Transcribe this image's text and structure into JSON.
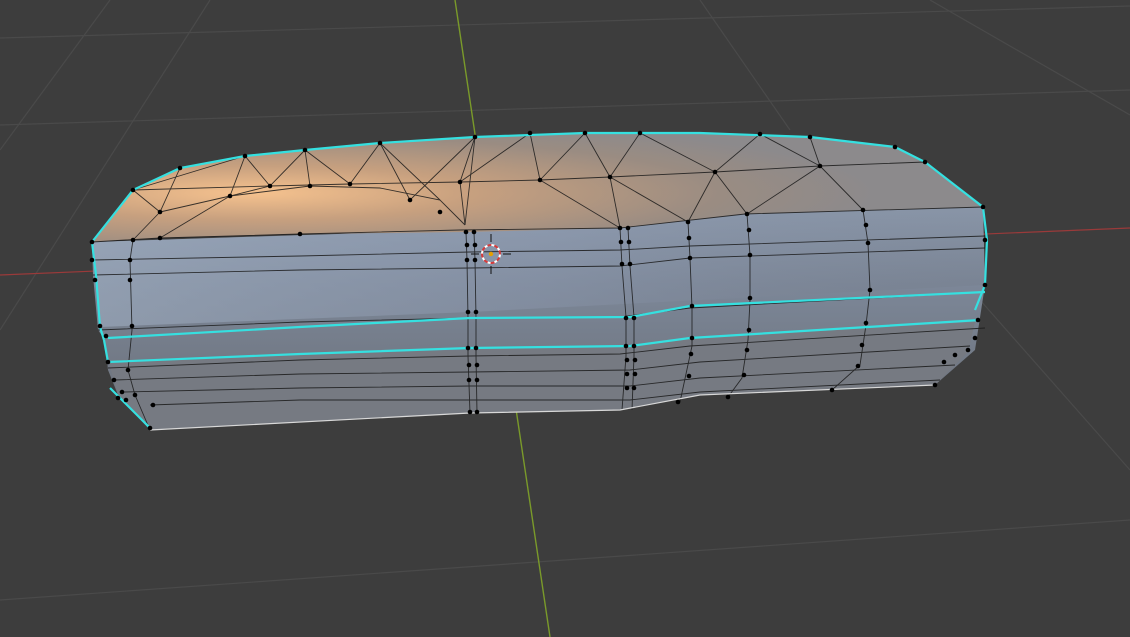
{
  "viewport": {
    "background_color": "#3d3d3d",
    "grid_color": "#4a4a4a",
    "x_axis_color": "#9a3a3a",
    "y_axis_color": "#7a9a2a",
    "mesh": {
      "face_top_color": "#c9a27e",
      "face_side_color": "#8a929e",
      "edge_color": "#1a1a1a",
      "selected_edge_color": "#35e0e0",
      "vertex_color": "#000000"
    },
    "cursor_icon": "3d-cursor-icon"
  }
}
